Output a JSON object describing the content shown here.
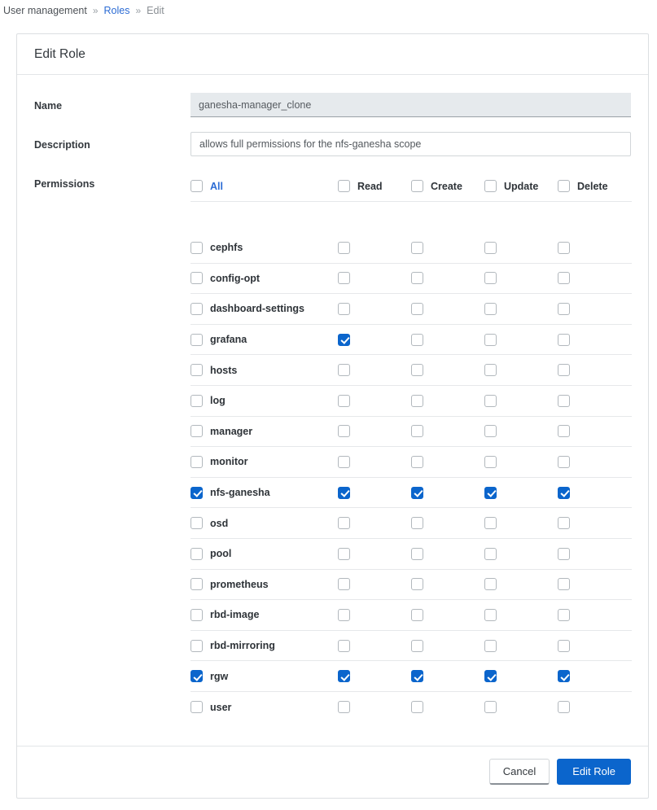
{
  "breadcrumb": {
    "separator": "»",
    "items": [
      {
        "label": "User management",
        "state": "plain"
      },
      {
        "label": "Roles",
        "state": "link"
      },
      {
        "label": "Edit",
        "state": "active"
      }
    ]
  },
  "card": {
    "title": "Edit Role"
  },
  "form": {
    "name": {
      "label": "Name",
      "value": "ganesha-manager_clone",
      "placeholder": "Name",
      "disabled": true
    },
    "description": {
      "label": "Description",
      "value": "allows full permissions for the nfs-ganesha scope",
      "placeholder": "Description",
      "disabled": false
    },
    "permissions": {
      "label": "Permissions",
      "header": {
        "all_label": "All",
        "all_checked": false,
        "columns": [
          {
            "label": "Read",
            "checked": false
          },
          {
            "label": "Create",
            "checked": false
          },
          {
            "label": "Update",
            "checked": false
          },
          {
            "label": "Delete",
            "checked": false
          }
        ]
      },
      "rows": [
        {
          "scope": "cephfs",
          "scope_checked": false,
          "perms": [
            false,
            false,
            false,
            false
          ]
        },
        {
          "scope": "config-opt",
          "scope_checked": false,
          "perms": [
            false,
            false,
            false,
            false
          ]
        },
        {
          "scope": "dashboard-settings",
          "scope_checked": false,
          "perms": [
            false,
            false,
            false,
            false
          ]
        },
        {
          "scope": "grafana",
          "scope_checked": false,
          "perms": [
            true,
            false,
            false,
            false
          ]
        },
        {
          "scope": "hosts",
          "scope_checked": false,
          "perms": [
            false,
            false,
            false,
            false
          ]
        },
        {
          "scope": "log",
          "scope_checked": false,
          "perms": [
            false,
            false,
            false,
            false
          ]
        },
        {
          "scope": "manager",
          "scope_checked": false,
          "perms": [
            false,
            false,
            false,
            false
          ]
        },
        {
          "scope": "monitor",
          "scope_checked": false,
          "perms": [
            false,
            false,
            false,
            false
          ]
        },
        {
          "scope": "nfs-ganesha",
          "scope_checked": true,
          "perms": [
            true,
            true,
            true,
            true
          ]
        },
        {
          "scope": "osd",
          "scope_checked": false,
          "perms": [
            false,
            false,
            false,
            false
          ]
        },
        {
          "scope": "pool",
          "scope_checked": false,
          "perms": [
            false,
            false,
            false,
            false
          ]
        },
        {
          "scope": "prometheus",
          "scope_checked": false,
          "perms": [
            false,
            false,
            false,
            false
          ]
        },
        {
          "scope": "rbd-image",
          "scope_checked": false,
          "perms": [
            false,
            false,
            false,
            false
          ]
        },
        {
          "scope": "rbd-mirroring",
          "scope_checked": false,
          "perms": [
            false,
            false,
            false,
            false
          ]
        },
        {
          "scope": "rgw",
          "scope_checked": true,
          "perms": [
            true,
            true,
            true,
            true
          ]
        },
        {
          "scope": "user",
          "scope_checked": false,
          "perms": [
            false,
            false,
            false,
            false
          ]
        }
      ]
    }
  },
  "footer": {
    "cancel_label": "Cancel",
    "submit_label": "Edit Role"
  },
  "colors": {
    "accent": "#0b65cc",
    "link": "#2b6bd4",
    "muted": "#8a8f94",
    "border": "#dcdfe2"
  }
}
